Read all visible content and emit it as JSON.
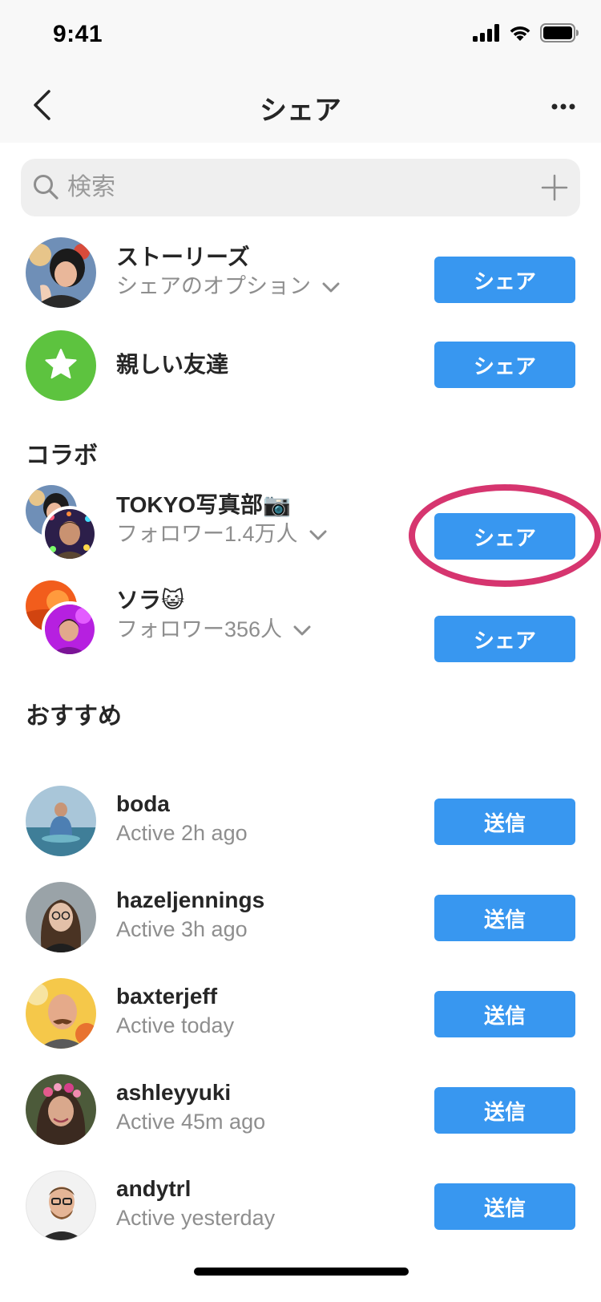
{
  "status_bar": {
    "time": "9:41",
    "signal_icon": "cellular-signal-icon",
    "wifi_icon": "wifi-icon",
    "battery_icon": "battery-icon"
  },
  "nav": {
    "title": "シェア",
    "back_icon": "chevron-left-icon",
    "more_icon": "more-horizontal-icon"
  },
  "search": {
    "placeholder": "検索",
    "value": "",
    "search_icon": "search-icon",
    "add_icon": "plus-icon"
  },
  "share_targets": [
    {
      "name": "ストーリーズ",
      "subtitle": "シェアのオプション",
      "button": "シェア"
    },
    {
      "name": "親しい友達",
      "button": "シェア"
    }
  ],
  "collab": {
    "header": "コラボ",
    "items": [
      {
        "name": "TOKYO写真部📷",
        "subtitle": "フォロワー1.4万人",
        "button": "シェア"
      },
      {
        "name": "ソラ😺",
        "subtitle": "フォロワー356人",
        "button": "シェア"
      }
    ]
  },
  "suggested": {
    "header": "おすすめ",
    "items": [
      {
        "name": "boda",
        "status": "Active 2h ago",
        "button": "送信"
      },
      {
        "name": "hazeljennings",
        "status": "Active 3h ago",
        "button": "送信"
      },
      {
        "name": "baxterjeff",
        "status": "Active today",
        "button": "送信"
      },
      {
        "name": "ashleyyuki",
        "status": "Active 45m ago",
        "button": "送信"
      },
      {
        "name": "andytrl",
        "status": "Active yesterday",
        "button": "送信"
      }
    ]
  },
  "colors": {
    "accent": "#3897f0",
    "close_friends": "#5dc33f",
    "highlight": "#d6356f"
  }
}
